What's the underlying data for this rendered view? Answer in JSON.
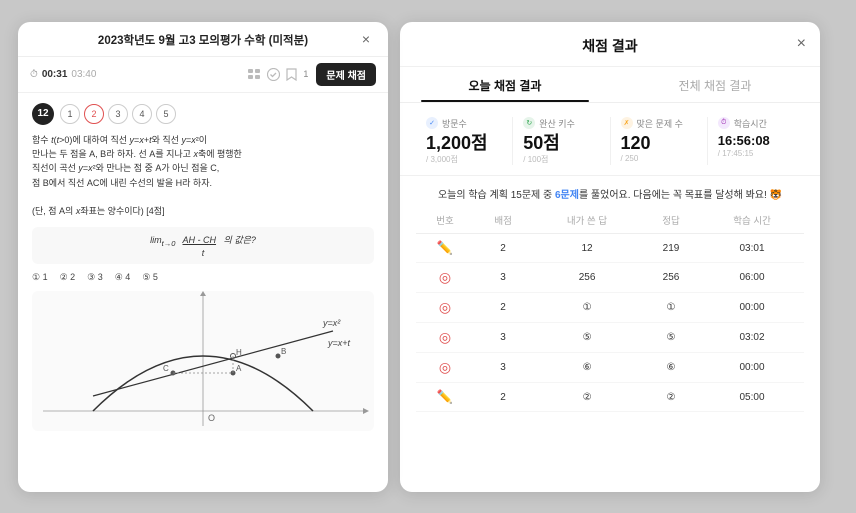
{
  "left": {
    "title": "2023학년도 9월 고3 모의평가 수학 (미적분)",
    "close_label": "×",
    "timer": {
      "current": "00:31",
      "total": "03:40"
    },
    "toolbar": {
      "icons": [
        {
          "name": "전체",
          "label": "전체"
        },
        {
          "name": "오답만",
          "label": "오답만"
        },
        {
          "name": "스크랩",
          "label": "스크랩"
        },
        {
          "name": "n",
          "label": "1"
        }
      ],
      "grade_btn": "문제 채점"
    },
    "question": {
      "number": "12",
      "options": [
        "1",
        "2",
        "3",
        "4",
        "5"
      ],
      "selected_option": "2",
      "text": "함수 t(t>0)에 대하여 직선 y=x+t와 직선 y=x²이\n만나는 두 점을 A, B라 하자. 선 A를 지나고 x축에 평행한\n직선이 곡선 y=x²와 만나는 점 중 A가 아닌 점을 C,\n점 B에서 직선 AC에 내린 수선의 발을 H라 하자.",
      "formula": "lim AH-CH / t→0  t",
      "choices": [
        "① 1",
        "② 2",
        "③ 3",
        "④ 4",
        "⑤ 5"
      ],
      "choice_note": "(단, 점 A의 x좌표는 양수이다) [4점]"
    }
  },
  "right": {
    "title": "채점 결과",
    "close_label": "×",
    "tabs": [
      {
        "label": "오늘 채점 결과",
        "active": true
      },
      {
        "label": "전체 채점 결과",
        "active": false
      }
    ],
    "stats": [
      {
        "icon_type": "blue",
        "icon_symbol": "✓",
        "label": "방문수",
        "value": "1,200점",
        "sub": "/ 3,000점"
      },
      {
        "icon_type": "green",
        "icon_symbol": "↻",
        "label": "완산 키수",
        "value": "50점",
        "sub": "/ 100점"
      },
      {
        "icon_type": "orange",
        "icon_symbol": "✗",
        "label": "맞은 문제 수",
        "value": "120",
        "sub": "/ 250"
      },
      {
        "icon_type": "purple",
        "icon_symbol": "⏱",
        "label": "학습시간",
        "value": "16:56:08",
        "sub": "/ 17:45:15"
      }
    ],
    "motivation": "오늘의 학습 계획 15문제 중 6문제를 풀었어요. 다음에는 꼭 목표를 달성해 봐요! 🐯",
    "table": {
      "headers": [
        "번호",
        "배점",
        "내가 쓴 답",
        "정답",
        "학습 시간"
      ],
      "rows": [
        {
          "number": "—",
          "status": "correct",
          "score": "2",
          "my_answer": "12",
          "answer": "219",
          "time": "03:01"
        },
        {
          "number": "—",
          "status": "wrong",
          "score": "3",
          "my_answer": "256",
          "answer": "256",
          "time": "06:00"
        },
        {
          "number": "—",
          "status": "wrong",
          "score": "2",
          "my_answer": "①",
          "answer": "①",
          "time": "00:00"
        },
        {
          "number": "—",
          "status": "wrong",
          "score": "3",
          "my_answer": "⑤",
          "answer": "⑤",
          "time": "03:02"
        },
        {
          "number": "—",
          "status": "wrong",
          "score": "3",
          "my_answer": "⑥",
          "answer": "⑥",
          "time": "00:00"
        },
        {
          "number": "—",
          "status": "correct",
          "score": "2",
          "my_answer": "②",
          "answer": "②",
          "time": "05:00"
        }
      ]
    }
  }
}
